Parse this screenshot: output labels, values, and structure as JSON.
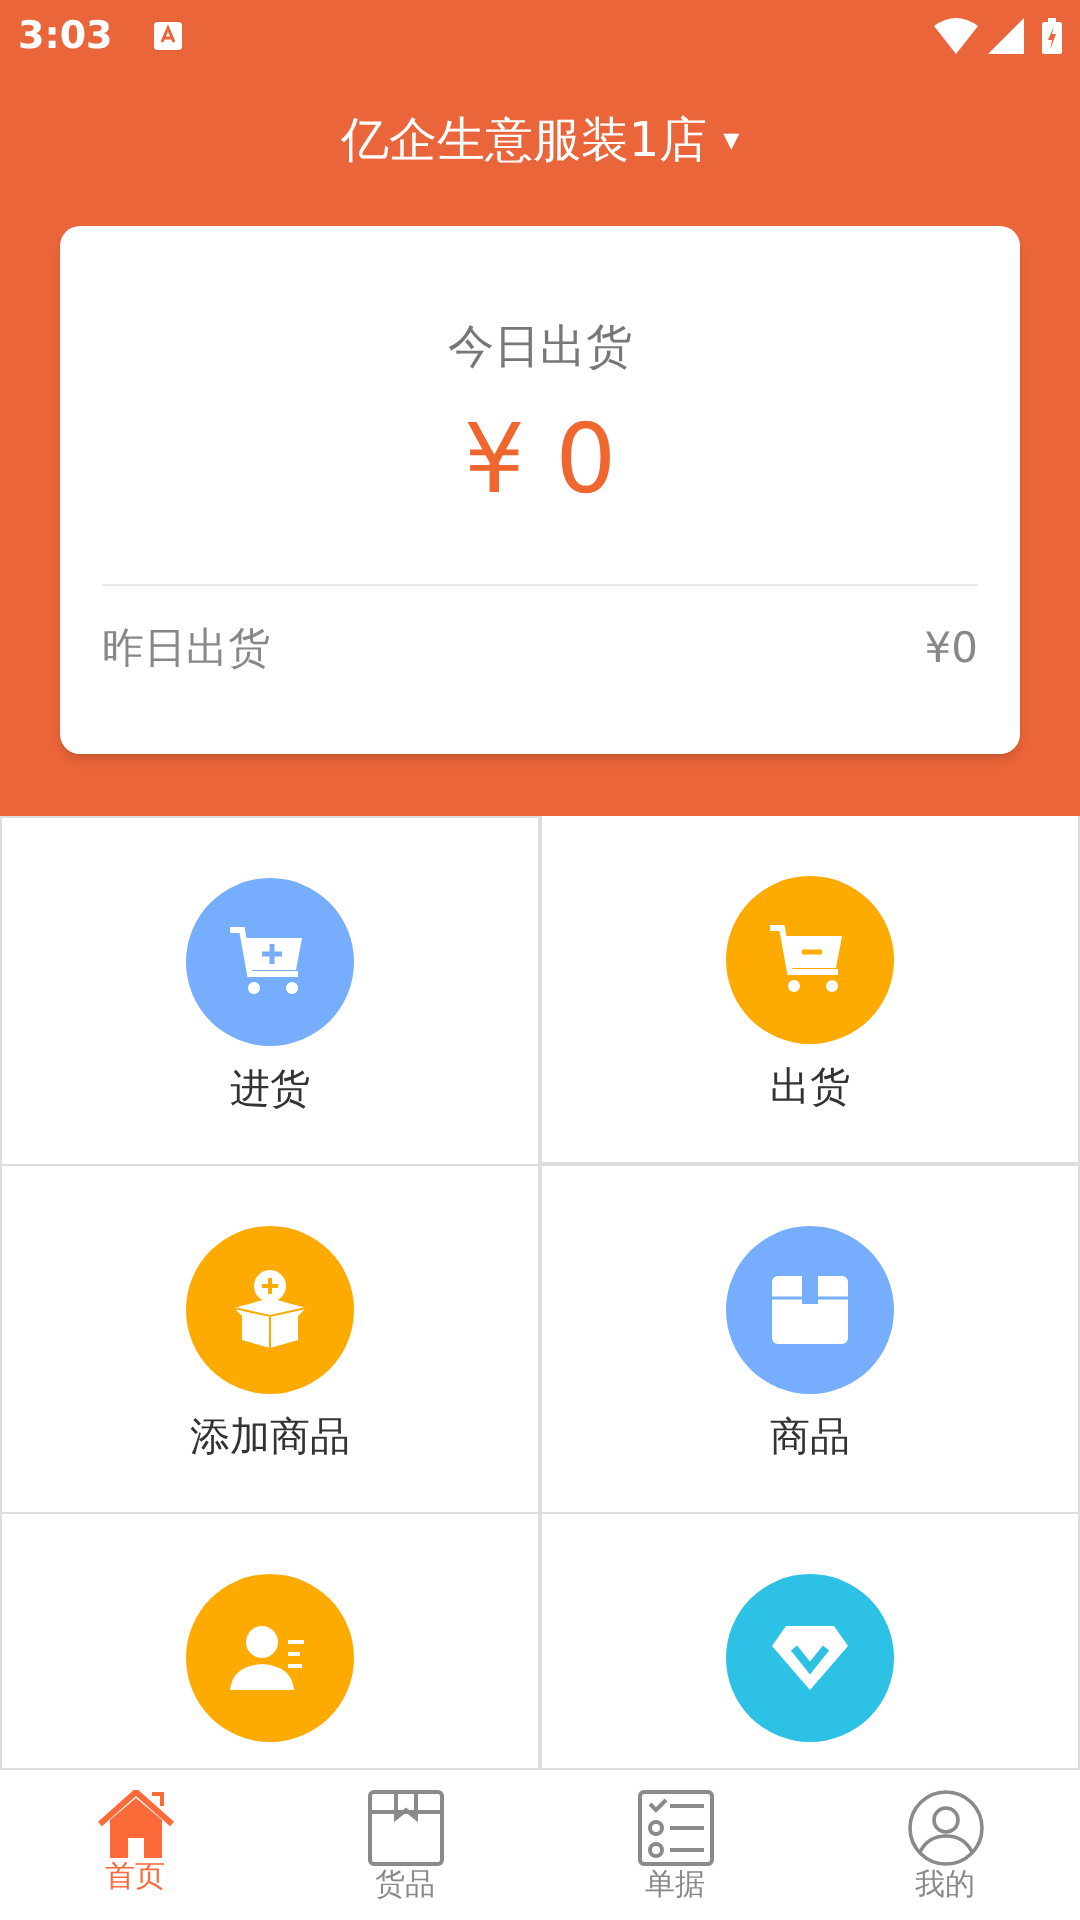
{
  "status_bar": {
    "time": "3:03"
  },
  "header": {
    "store_name": "亿企生意服装1店",
    "dropdown": "▾"
  },
  "summary_card": {
    "title": "今日出货",
    "amount": "¥ 0",
    "footer_label": "昨日出货",
    "footer_value": "¥0"
  },
  "grid": [
    {
      "label": "进货",
      "color": "#76adfc"
    },
    {
      "label": "出货",
      "color": "#fdab00"
    },
    {
      "label": "添加商品",
      "color": "#fdab00"
    },
    {
      "label": "商品",
      "color": "#76adfc"
    },
    {
      "color": "#fdab00"
    },
    {
      "color": "#2ec1e6"
    }
  ],
  "tabs": [
    {
      "label": "首页",
      "selected": true
    },
    {
      "label": "货品",
      "selected": false
    },
    {
      "label": "单据",
      "selected": false
    },
    {
      "label": "我的",
      "selected": false
    }
  ]
}
